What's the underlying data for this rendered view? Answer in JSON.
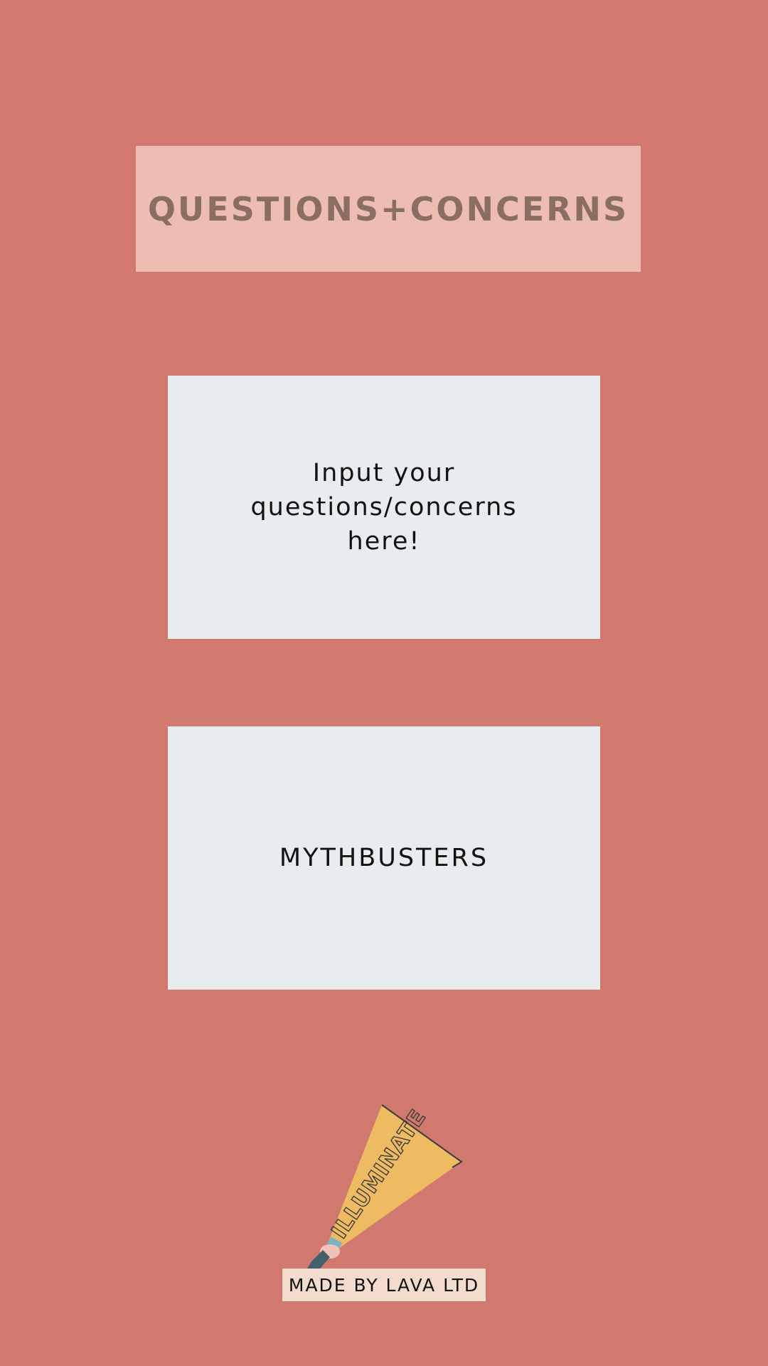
{
  "header": {
    "title": "QUESTIONS+CONCERNS"
  },
  "cards": {
    "input": {
      "label": "Input your questions/concerns here!"
    },
    "mythbusters": {
      "label": "MYTHBUSTERS"
    }
  },
  "illustration": {
    "icon": "megaphone-icon",
    "text": "ILLUMINATE"
  },
  "footer": {
    "label": "MADE BY LAVA LTD"
  },
  "colors": {
    "background": "#d1786f",
    "header_box": "#edbcb3",
    "header_text": "#8a6e63",
    "card": "#e9ecee",
    "megaphone": "#eebb62",
    "footer_badge": "#f3dccd"
  }
}
